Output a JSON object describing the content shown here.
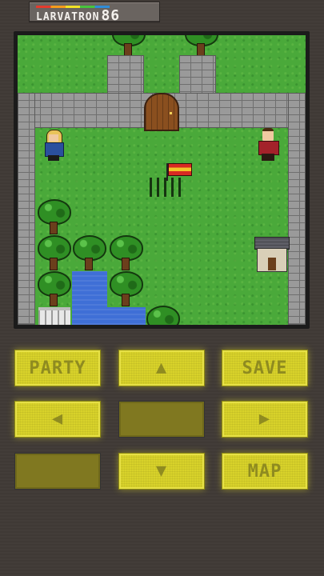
{
  "app": {
    "title": "LARVATRON",
    "model": "86"
  },
  "controls": {
    "party_label": "PARTY",
    "up_icon": "arrow-up-icon",
    "save_label": "SAVE",
    "left_icon": "arrow-left-icon",
    "right_icon": "arrow-right-icon",
    "down_icon": "arrow-down-icon",
    "map_label": "MAP",
    "glyphs": {
      "up": "▲",
      "down": "▼",
      "left": "◀",
      "right": "▶"
    }
  },
  "colors": {
    "button_active": "#d8d22a",
    "button_dim": "#807820",
    "grass": "#4aa93a",
    "background": "#403a36"
  }
}
